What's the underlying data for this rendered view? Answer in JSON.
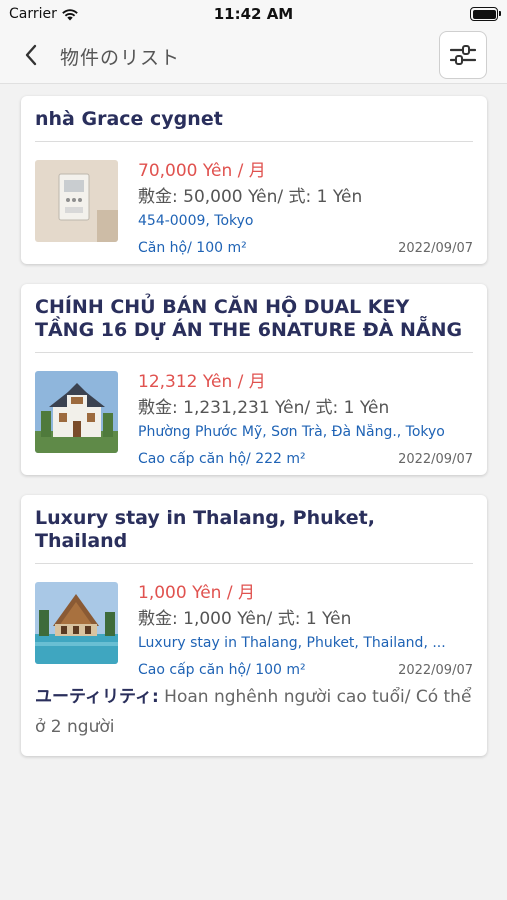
{
  "status_bar": {
    "carrier": "Carrier",
    "time": "11:42 AM"
  },
  "nav": {
    "title": "物件のリスト"
  },
  "listings": [
    {
      "title": "nhà Grace cygnet",
      "price": "70,000 Yên / 月",
      "deposit": "敷金: 50,000 Yên/ 式: 1 Yên",
      "address": "454-0009, Tokyo",
      "type": "Căn hộ/ 100 m²",
      "date": "2022/09/07"
    },
    {
      "title": "CHÍNH CHỦ BÁN CĂN HỘ DUAL KEY TẦNG 16 DỰ ÁN THE 6NATURE ĐÀ NẴNG",
      "price": "12,312 Yên / 月",
      "deposit": "敷金: 1,231,231 Yên/ 式: 1 Yên",
      "address": "Phường Phước Mỹ, Sơn Trà, Đà Nẵng., Tokyo",
      "type": "Cao cấp căn hộ/ 222 m²",
      "date": "2022/09/07"
    },
    {
      "title": "Luxury stay in Thalang, Phuket, Thailand",
      "price": "1,000 Yên / 月",
      "deposit": "敷金: 1,000 Yên/ 式: 1 Yên",
      "address": "Luxury stay in Thalang, Phuket, Thailand, ...",
      "type": "Cao cấp căn hộ/ 100 m²",
      "date": "2022/09/07",
      "utility_label": "ユーティリティ:",
      "utility_text": "Hoan nghênh người cao tuổi/ Có thể ở 2 người"
    }
  ],
  "colors": {
    "accent_price": "#e0524f",
    "link_blue": "#1f63b5",
    "title_navy": "#2a2f5c"
  }
}
